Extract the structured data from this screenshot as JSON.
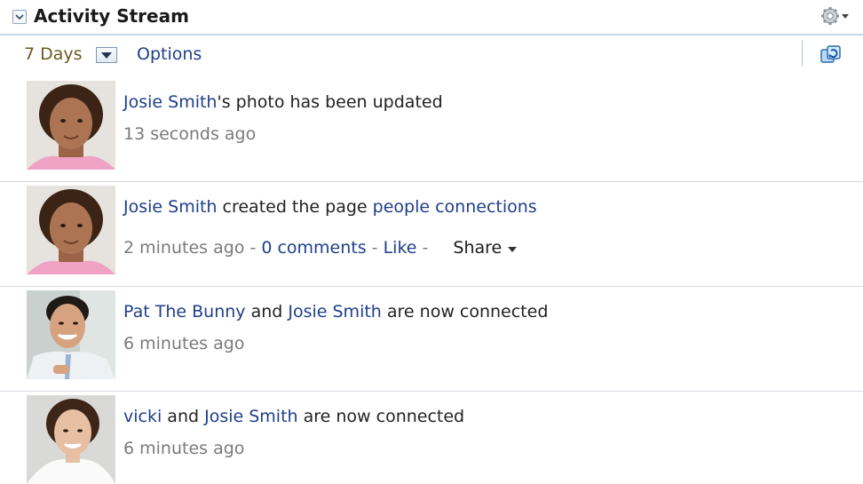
{
  "header": {
    "title": "Activity Stream"
  },
  "toolbar": {
    "days": "7 Days",
    "options": "Options"
  },
  "items": [
    {
      "actor": "Josie Smith",
      "text1": "'s photo has been updated",
      "time": "13 seconds ago"
    },
    {
      "actor": "Josie Smith",
      "text1": " created the page ",
      "target": "people connections",
      "time": "2 minutes ago",
      "sep1": " - ",
      "comments": "0 comments",
      "sep2": " - ",
      "like": "Like",
      "sep3": " - ",
      "share": "Share"
    },
    {
      "actor": "Pat The Bunny",
      "text1": " and ",
      "actor2": "Josie Smith",
      "text2": " are now connected",
      "time": "6 minutes ago"
    },
    {
      "actor": "vicki",
      "text1": " and ",
      "actor2": "Josie Smith",
      "text2": " are now connected",
      "time": "6 minutes ago"
    }
  ]
}
